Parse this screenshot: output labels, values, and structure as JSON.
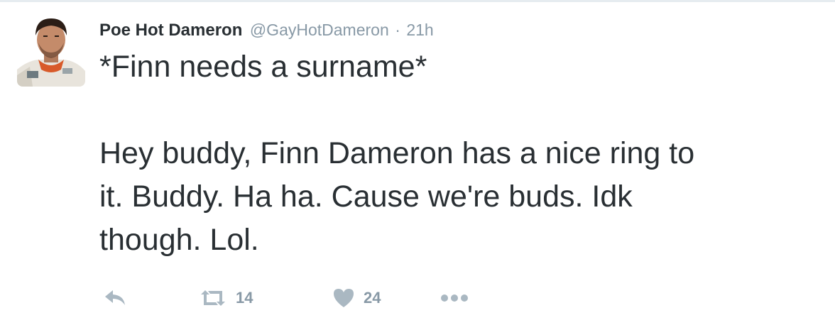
{
  "tweet": {
    "author": {
      "name": "Poe Hot Dameron",
      "handle": "@GayHotDameron"
    },
    "separator": "·",
    "time": "21h",
    "lines": [
      "*Finn needs a surname*",
      "Hey buddy, Finn Dameron has a nice ring to",
      "it. Buddy. Ha ha. Cause we're buds. Idk",
      "though. Lol."
    ],
    "actions": {
      "retweet_count": "14",
      "like_count": "24"
    }
  },
  "colors": {
    "text": "#292f33",
    "muted": "#8899a6",
    "icon": "#aab8c2",
    "border": "#e6ecf0"
  },
  "icons": {
    "reply": "reply-icon",
    "retweet": "retweet-icon",
    "like": "heart-icon",
    "more": "more-icon"
  }
}
